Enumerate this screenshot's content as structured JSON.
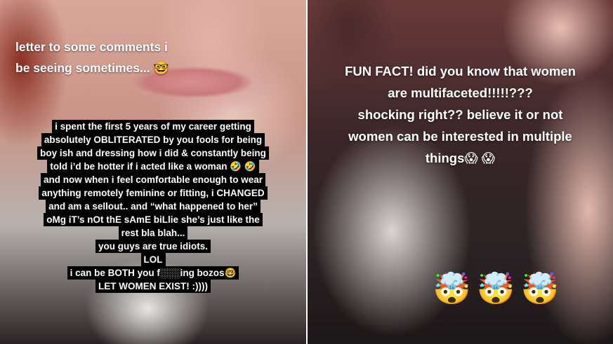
{
  "left_panel": {
    "caption_lines": [
      "letter to some comments i",
      "be seeing sometimes... 🤓"
    ],
    "letter_lines": [
      "i spent the first 5 years of my career getting",
      "absolutely OBLITERATED by you fools for being",
      "boy ish and dressing how i did & constantly being",
      "told i’d be hotter if i acted like a woman 🤣 🤣",
      "and now when i feel comfortable enough to wear",
      "anything remotely feminine or fitting, i CHANGED",
      "and am a sellout.. and “what happened to her”",
      "oMg iT’s nOt thE sAmE biLlie she’s just like the",
      "rest bla blah...",
      "you guys are true idiots.",
      "LOL",
      "i can be BOTH you f░░░ing bozos🤓",
      "LET WOMEN EXIST! :))))"
    ]
  },
  "right_panel": {
    "fact_lines": [
      "FUN FACT! did you know that women",
      "are multifaceted!!!!!???",
      "shocking right?? believe it or not",
      "women can be interested in multiple",
      "things😱 😱"
    ],
    "stickers": [
      "🤯",
      "🤯",
      "🤯"
    ]
  }
}
